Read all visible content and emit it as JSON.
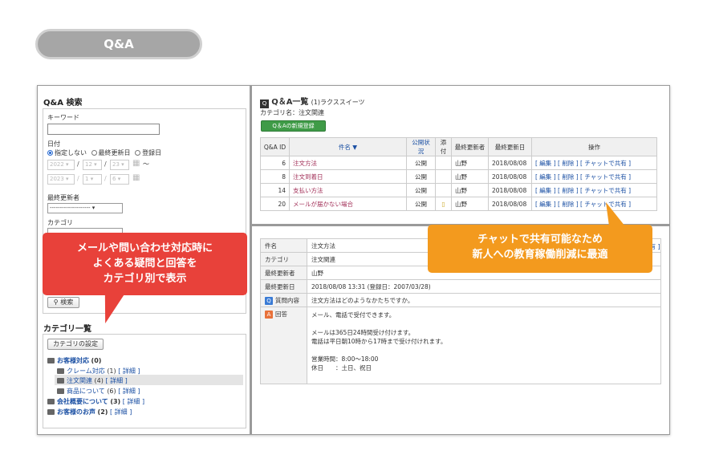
{
  "header_pill": "Q&A",
  "search": {
    "title": "Q&A 検索",
    "keyword_label": "キーワード",
    "date_label": "日付",
    "radio": [
      "指定しない",
      "最終更新日",
      "登録日"
    ],
    "date_from": {
      "year": "2022",
      "month": "12",
      "day": "23"
    },
    "date_to": {
      "year": "2023",
      "month": "1",
      "day": "6"
    },
    "tilde": "〜",
    "updater_label": "最終更新者",
    "updater_value": "--------------------",
    "category_label": "カテゴリ",
    "search_button": "検索"
  },
  "category_list": {
    "title": "カテゴリ一覧",
    "settings_button": "カテゴリの設定",
    "items": [
      {
        "label": "お客様対応",
        "count": "(0)"
      },
      {
        "label": "クレーム対応",
        "count": "(1)",
        "detail": "[ 詳細 ]"
      },
      {
        "label": "注文関連",
        "count": "(4)",
        "detail": "[ 詳細 ]"
      },
      {
        "label": "商品について",
        "count": "(6)",
        "detail": "[ 詳細 ]"
      },
      {
        "label": "会社概要について",
        "count": "(3)",
        "detail": "[ 詳細 ]"
      },
      {
        "label": "お客様のお声",
        "count": "(2)",
        "detail": "[ 詳細 ]"
      }
    ]
  },
  "list": {
    "title": "Q＆A一覧",
    "subtitle": "(1)ラクススイーツ",
    "category_line": "カテゴリ名：注文関連",
    "new_button": "Q＆Aの新規登録",
    "columns": [
      "Q&A ID",
      "件名 ▼",
      "公開状況",
      "添付",
      "最終更新者",
      "最終更新日",
      "操作"
    ],
    "rows": [
      {
        "id": "6",
        "subject": "注文方法",
        "status": "公開",
        "updater": "山野",
        "date": "2018/08/08"
      },
      {
        "id": "8",
        "subject": "注文到着日",
        "status": "公開",
        "updater": "山野",
        "date": "2018/08/08"
      },
      {
        "id": "14",
        "subject": "支払い方法",
        "status": "公開",
        "updater": "山野",
        "date": "2018/08/08"
      },
      {
        "id": "20",
        "subject": "メールが届かない場合",
        "status": "公開",
        "updater": "山野",
        "date": "2018/08/08"
      }
    ],
    "actions": "[ 編集 ] [ 削除 ] [ チャットで共有 ]"
  },
  "detail": {
    "rows": [
      {
        "key": "件名",
        "value": "注文方法"
      },
      {
        "key": "カテゴリ",
        "value": "注文関連"
      },
      {
        "key": "最終更新者",
        "value": "山野"
      },
      {
        "key": "最終更新日",
        "value": "2018/08/08 13:31 (登録日：2007/03/28)"
      }
    ],
    "question_key": "質問内容",
    "question": "注文方法はどのようなかたちですか。",
    "answer_key": "回答",
    "answer_lines": [
      "メール、電話で受付できます。",
      "",
      "メールは365日24時間受け付けます。",
      "電話は平日朝10時から17時まで受け付けれます。",
      "",
      "営業時間：8:00〜18:00",
      "休日　　：土日、祝日"
    ],
    "top_right_fragment": "有 ]"
  },
  "callouts": {
    "left": [
      "メールや問い合わせ対応時に",
      "よくある疑問と回答を",
      "カテゴリ別で表示"
    ],
    "right": [
      "チャットで共有可能なため",
      "新人への教育稼働削減に最適"
    ]
  },
  "colors": {
    "callout_red": "#e8413a",
    "callout_orange": "#f39a1e",
    "new_button_green": "#3f9b47",
    "link_blue": "#1a4fa3",
    "subject_red": "#a3325a"
  }
}
